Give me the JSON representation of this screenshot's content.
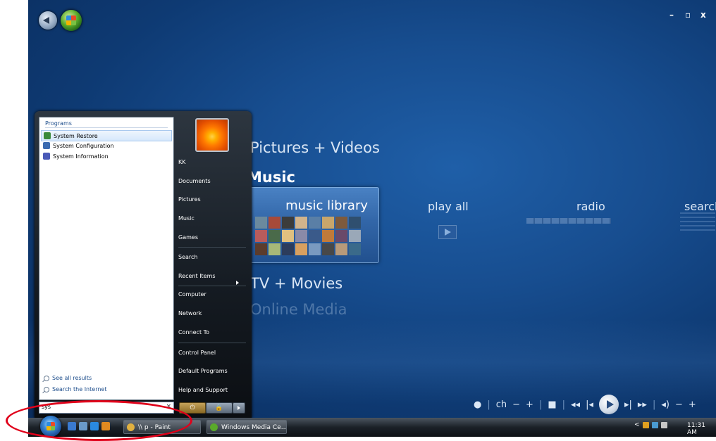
{
  "media_center": {
    "window_controls": [
      "–",
      "▫",
      "x"
    ],
    "categories": {
      "pictures": "Pictures + Videos",
      "music": "Music",
      "tv": "TV + Movies",
      "online": "Online Media"
    },
    "strip": {
      "music_library": "music library",
      "play_all": "play all",
      "radio": "radio",
      "search": "search"
    },
    "album_colors": [
      "#6b8a9e",
      "#a74a3a",
      "#3c3c3c",
      "#d2b48c",
      "#5a7fa6",
      "#c9a66b",
      "#7e5a3c",
      "#2f4f6f",
      "#b85c5c",
      "#4a6a4a",
      "#e0c080",
      "#8a8aa8",
      "#3a5a8a",
      "#c07a3a",
      "#6a4a6a",
      "#9aa8b8",
      "#5c3c2c",
      "#a8b878",
      "#2c3c5c",
      "#d8a060",
      "#7a9ac0",
      "#484848",
      "#b89a7a",
      "#3a6a8a"
    ],
    "transport": {
      "dot": "●",
      "ch": "ch",
      "minus": "−",
      "plus": "+",
      "stop": "■",
      "rewind": "◂◂",
      "prev": "|◂",
      "next": "▸|",
      "ffwd": "▸▸",
      "volume": "◂)",
      "vol_minus": "−",
      "vol_plus": "+",
      "sep": "|"
    }
  },
  "start_menu": {
    "programs_header": "Programs",
    "programs": [
      {
        "label": "System Restore",
        "color": "#3a8a3a"
      },
      {
        "label": "System Configuration",
        "color": "#3a6ab0"
      },
      {
        "label": "System Information",
        "color": "#4a5ab8"
      }
    ],
    "see_all": "See all results",
    "search_internet": "Search the Internet",
    "search_value": "sys",
    "search_clear": "×",
    "right_items": {
      "user": "KK",
      "documents": "Documents",
      "pictures": "Pictures",
      "music": "Music",
      "games": "Games",
      "search": "Search",
      "recent": "Recent Items",
      "computer": "Computer",
      "network": "Network",
      "connect": "Connect To",
      "control_panel": "Control Panel",
      "default_programs": "Default Programs",
      "help": "Help and Support"
    },
    "power_symbol": "⏻",
    "lock_symbol": "🔒"
  },
  "taskbar": {
    "tasks": [
      {
        "label": "\\\\ p - Paint",
        "color": "#e0b040"
      },
      {
        "label": "Windows Media Ce...",
        "color": "#5aaa2a"
      }
    ],
    "tray_chevron": "<",
    "clock": "11:31 AM",
    "quick_launch_colors": [
      "#3a7ad0",
      "#6a9ac8",
      "#2a8ae0",
      "#e08a20"
    ]
  }
}
